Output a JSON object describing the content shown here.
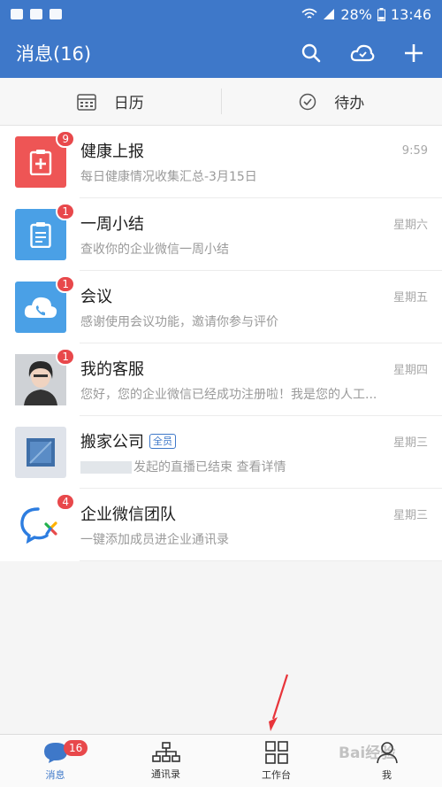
{
  "status_bar": {
    "battery": "28%",
    "time": "13:46"
  },
  "app_bar": {
    "title": "消息(16)"
  },
  "quick_bar": {
    "calendar_label": "日历",
    "todo_label": "待办"
  },
  "messages": [
    {
      "name": "健康上报",
      "tag": "",
      "time": "9:59",
      "preview": "每日健康情况收集汇总-3月15日",
      "badge": "9",
      "color": "#ee5555"
    },
    {
      "name": "一周小结",
      "tag": "",
      "time": "星期六",
      "preview": "查收你的企业微信一周小结",
      "badge": "1",
      "color": "#4aa0e6"
    },
    {
      "name": "会议",
      "tag": "",
      "time": "星期五",
      "preview": "感谢使用会议功能，邀请你参与评价",
      "badge": "1",
      "color": "#4aa0e6"
    },
    {
      "name": "我的客服",
      "tag": "",
      "time": "星期四",
      "preview": "您好，您的企业微信已经成功注册啦！我是您的人工...",
      "badge": "1",
      "color": "#c8c8c8"
    },
    {
      "name": "搬家公司",
      "tag": "全员",
      "time": "星期三",
      "preview": "发起的直播已结束 查看详情",
      "badge": "",
      "color": "#dfe3ea"
    },
    {
      "name": "企业微信团队",
      "tag": "",
      "time": "星期三",
      "preview": "一键添加成员进企业通讯录",
      "badge": "4",
      "color": "#ffffff"
    }
  ],
  "tab_bar": {
    "messages_label": "消息",
    "messages_badge": "16",
    "contacts_label": "通讯录",
    "workbench_label": "工作台",
    "me_label": "我"
  },
  "watermark": "Bai经验",
  "colors": {
    "accent": "#3e78c9",
    "badge": "#e8484b"
  }
}
